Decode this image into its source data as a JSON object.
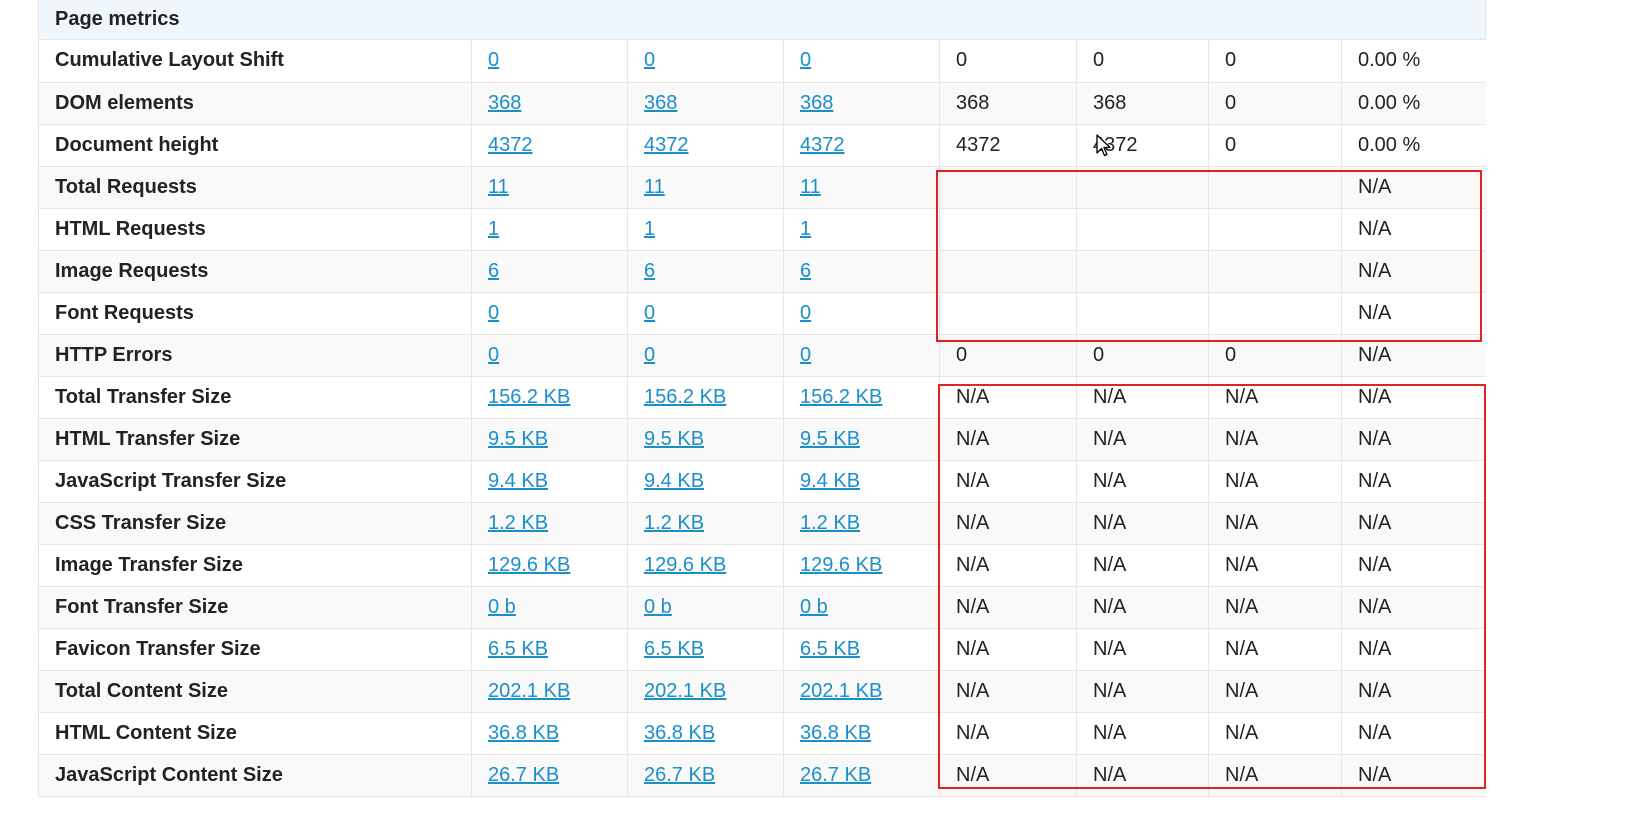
{
  "section": {
    "title": "Page metrics"
  },
  "rows": [
    {
      "label": "Cumulative Layout Shift",
      "links": [
        "0",
        "0",
        "0"
      ],
      "values": [
        "0",
        "0",
        "0",
        "0.00 %"
      ]
    },
    {
      "label": "DOM elements",
      "links": [
        "368",
        "368",
        "368"
      ],
      "values": [
        "368",
        "368",
        "0",
        "0.00 %"
      ]
    },
    {
      "label": "Document height",
      "links": [
        "4372",
        "4372",
        "4372"
      ],
      "values": [
        "4372",
        "4372",
        "0",
        "0.00 %"
      ]
    },
    {
      "label": "Total Requests",
      "links": [
        "11",
        "11",
        "11"
      ],
      "values": [
        "",
        "",
        "",
        "N/A"
      ]
    },
    {
      "label": "HTML Requests",
      "links": [
        "1",
        "1",
        "1"
      ],
      "values": [
        "",
        "",
        "",
        "N/A"
      ]
    },
    {
      "label": "Image Requests",
      "links": [
        "6",
        "6",
        "6"
      ],
      "values": [
        "",
        "",
        "",
        "N/A"
      ]
    },
    {
      "label": "Font Requests",
      "links": [
        "0",
        "0",
        "0"
      ],
      "values": [
        "",
        "",
        "",
        "N/A"
      ]
    },
    {
      "label": "HTTP Errors",
      "links": [
        "0",
        "0",
        "0"
      ],
      "values": [
        "0",
        "0",
        "0",
        "N/A"
      ]
    },
    {
      "label": "Total Transfer Size",
      "links": [
        "156.2 KB",
        "156.2 KB",
        "156.2 KB"
      ],
      "values": [
        "N/A",
        "N/A",
        "N/A",
        "N/A"
      ]
    },
    {
      "label": "HTML Transfer Size",
      "links": [
        "9.5 KB",
        "9.5 KB",
        "9.5 KB"
      ],
      "values": [
        "N/A",
        "N/A",
        "N/A",
        "N/A"
      ]
    },
    {
      "label": "JavaScript Transfer Size",
      "links": [
        "9.4 KB",
        "9.4 KB",
        "9.4 KB"
      ],
      "values": [
        "N/A",
        "N/A",
        "N/A",
        "N/A"
      ]
    },
    {
      "label": "CSS Transfer Size",
      "links": [
        "1.2 KB",
        "1.2 KB",
        "1.2 KB"
      ],
      "values": [
        "N/A",
        "N/A",
        "N/A",
        "N/A"
      ]
    },
    {
      "label": "Image Transfer Size",
      "links": [
        "129.6 KB",
        "129.6 KB",
        "129.6 KB"
      ],
      "values": [
        "N/A",
        "N/A",
        "N/A",
        "N/A"
      ]
    },
    {
      "label": "Font Transfer Size",
      "links": [
        "0 b",
        "0 b",
        "0 b"
      ],
      "values": [
        "N/A",
        "N/A",
        "N/A",
        "N/A"
      ]
    },
    {
      "label": "Favicon Transfer Size",
      "links": [
        "6.5 KB",
        "6.5 KB",
        "6.5 KB"
      ],
      "values": [
        "N/A",
        "N/A",
        "N/A",
        "N/A"
      ]
    },
    {
      "label": "Total Content Size",
      "links": [
        "202.1 KB",
        "202.1 KB",
        "202.1 KB"
      ],
      "values": [
        "N/A",
        "N/A",
        "N/A",
        "N/A"
      ]
    },
    {
      "label": "HTML Content Size",
      "links": [
        "36.8 KB",
        "36.8 KB",
        "36.8 KB"
      ],
      "values": [
        "N/A",
        "N/A",
        "N/A",
        "N/A"
      ]
    },
    {
      "label": "JavaScript Content Size",
      "links": [
        "26.7 KB",
        "26.7 KB",
        "26.7 KB"
      ],
      "values": [
        "N/A",
        "N/A",
        "N/A",
        "N/A"
      ]
    }
  ],
  "colors": {
    "link": "#1a8fc9",
    "highlight": "#e02424",
    "header_bg": "#f0f7fc"
  },
  "icons": {
    "cursor": "mouse-pointer-icon"
  }
}
